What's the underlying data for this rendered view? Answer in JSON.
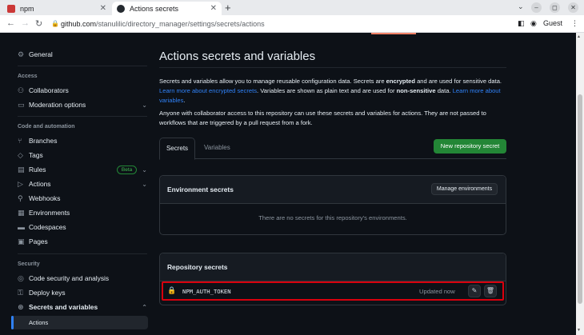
{
  "browser": {
    "tabs": [
      {
        "title": "npm",
        "active": false
      },
      {
        "title": "Actions secrets",
        "active": true
      }
    ],
    "new_tab": "+",
    "url_host": "github.com",
    "url_path": "/stanulilic/directory_manager/settings/secrets/actions",
    "profile": "Guest",
    "icons": [
      "back-arrow-icon",
      "forward-arrow-icon",
      "reload-icon",
      "lock-icon",
      "sidepanel-icon",
      "profile-icon",
      "menu-icon"
    ]
  },
  "sidebar": {
    "general": "General",
    "access_heading": "Access",
    "collaborators": "Collaborators",
    "moderation": "Moderation options",
    "code_heading": "Code and automation",
    "branches": "Branches",
    "tags": "Tags",
    "rules": "Rules",
    "rules_badge": "Beta",
    "actions": "Actions",
    "webhooks": "Webhooks",
    "environments": "Environments",
    "codespaces": "Codespaces",
    "pages": "Pages",
    "security_heading": "Security",
    "code_security": "Code security and analysis",
    "deploy_keys": "Deploy keys",
    "secrets_vars": "Secrets and variables",
    "sub_actions": "Actions"
  },
  "main": {
    "title": "Actions secrets and variables",
    "intro_1": "Secrets and variables allow you to manage reusable configuration data. Secrets are ",
    "intro_encrypted": "encrypted",
    "intro_2": " and are used for sensitive data. ",
    "intro_link1": "Learn more about encrypted secrets",
    "intro_3": ". Variables are shown as plain text and are used for ",
    "intro_nonsensitive": "non-sensitive",
    "intro_4": " data. ",
    "intro_link2": "Learn more about variables",
    "intro_5": ".",
    "collab_note": "Anyone with collaborator access to this repository can use these secrets and variables for actions. They are not passed to workflows that are triggered by a pull request from a fork.",
    "tab_secrets": "Secrets",
    "tab_variables": "Variables",
    "new_secret_button": "New repository secret",
    "env_title": "Environment secrets",
    "manage_env_button": "Manage environments",
    "env_empty": "There are no secrets for this repository's environments.",
    "repo_title": "Repository secrets",
    "secret_name": "NPM_AUTH_TOKEN",
    "secret_updated": "Updated now"
  },
  "colors": {
    "background": "#0d1117",
    "accent_green": "#238636",
    "link_blue": "#2f81f7",
    "highlight_red": "#d9000d"
  }
}
